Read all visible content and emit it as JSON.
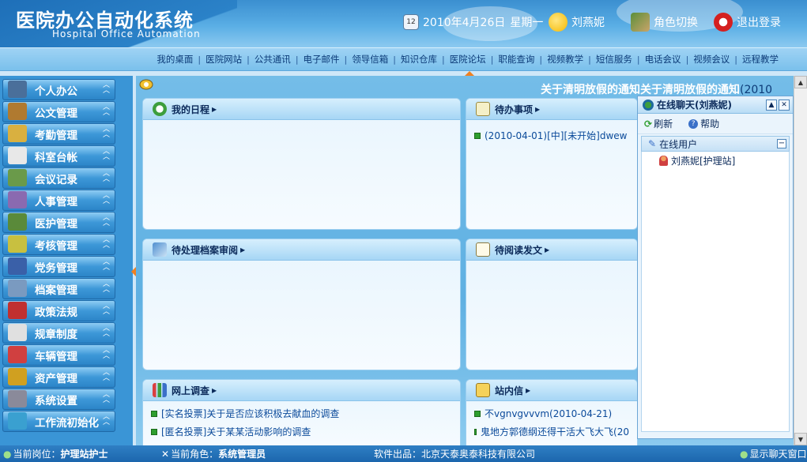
{
  "header": {
    "title_cn": "医院办公自动化系统",
    "title_en": "Hospital Office Automation",
    "date": "2010年4月26日",
    "weekday": "星期一",
    "user": "刘燕妮",
    "switch_role": "角色切换",
    "logout": "退出登录"
  },
  "topnav": [
    "我的桌面",
    "医院网站",
    "公共通讯",
    "电子邮件",
    "领导信箱",
    "知识仓库",
    "医院论坛",
    "职能查询",
    "视频教学",
    "短信服务",
    "电话会议",
    "视频会议",
    "远程教学"
  ],
  "sidebar": [
    "个人办公",
    "公文管理",
    "考勤管理",
    "科室台帐",
    "会议记录",
    "人事管理",
    "医护管理",
    "考核管理",
    "党务管理",
    "档案管理",
    "政策法规",
    "规章制度",
    "车辆管理",
    "资产管理",
    "系统设置",
    "工作流初始化"
  ],
  "marquee": {
    "text": "关于清明放假的通知关于清明放假的通知",
    "tail": "(2010"
  },
  "panels": {
    "schedule": {
      "title": "我的日程"
    },
    "todo": {
      "title": "待办事项",
      "items": [
        "(2010-04-01)[中][未开始]dwew"
      ]
    },
    "archive": {
      "title": "待处理档案审阅"
    },
    "docs": {
      "title": "待阅读发文"
    },
    "survey": {
      "title": "网上调查",
      "items": [
        "[实名投票]关于是否应该积极去献血的调查",
        "[匿名投票]关于某某活动影响的调查"
      ]
    },
    "mail": {
      "title": "站内信",
      "items": [
        "不vgnvgvvvm(2010-04-21)",
        "鬼地方郭德纲还得干活大飞大飞(20"
      ]
    }
  },
  "chat": {
    "title": "在线聊天(刘燕妮)",
    "refresh": "刷新",
    "help": "帮助",
    "group": "在线用户",
    "users": [
      "刘燕妮[护理站]"
    ]
  },
  "status": {
    "post_label": "当前岗位：",
    "post": "护理站护士",
    "role_label": "当前角色：",
    "role": "系统管理员",
    "vendor": "软件出品：北京天泰奥泰科技有限公司",
    "show_chat": "显示聊天窗口"
  },
  "colors": {
    "accent": "#3a95d6",
    "orange": "#f08020",
    "green_bullet": "#2e9e2e"
  }
}
